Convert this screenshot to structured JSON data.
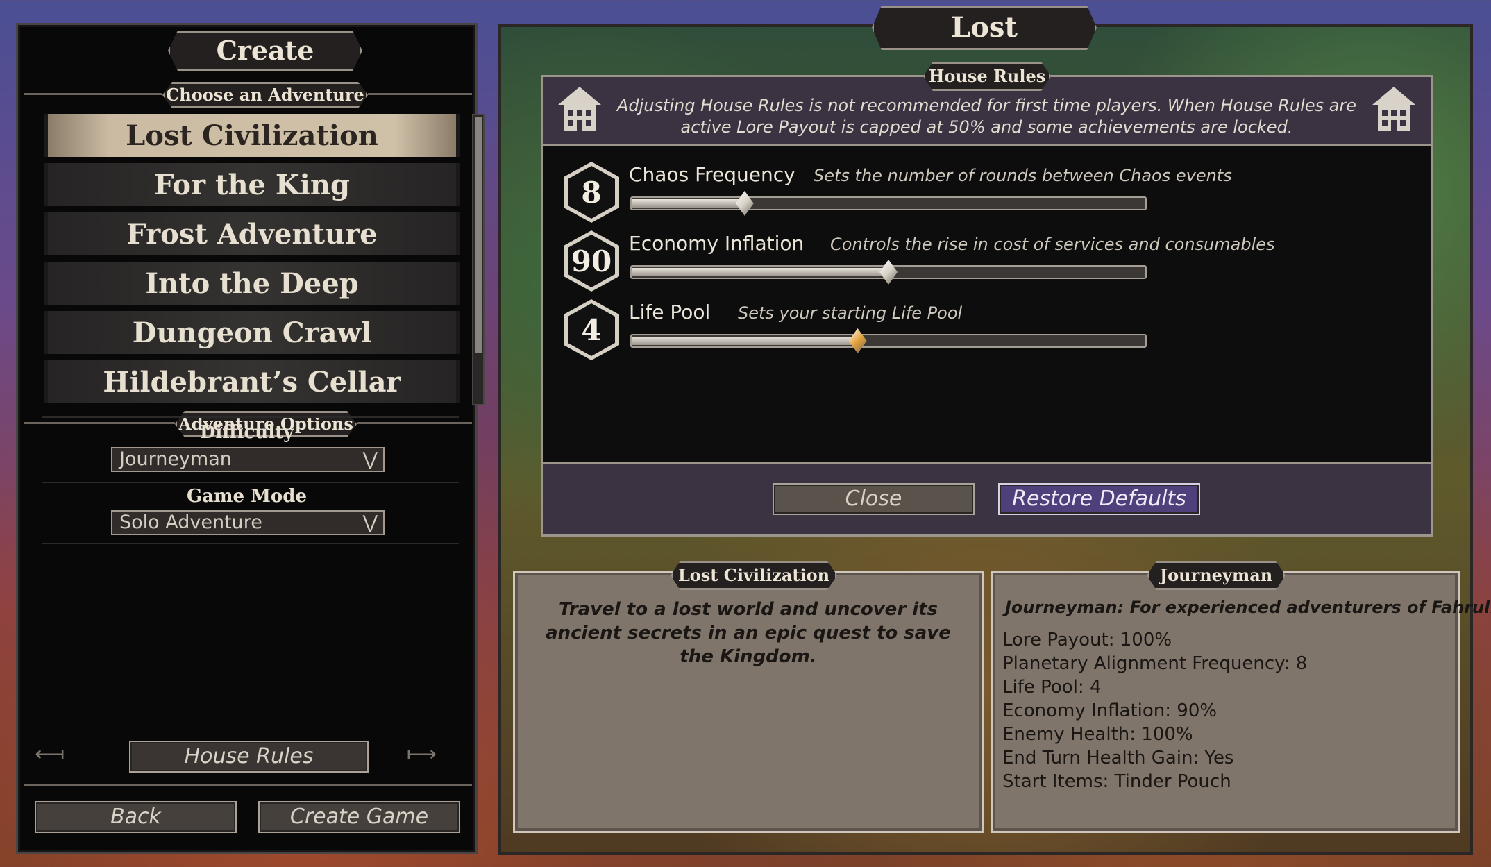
{
  "left_panel": {
    "title": "Create Game",
    "choose_adventure": "Choose an Adventure",
    "adventures": [
      {
        "label": "Lost Civilization",
        "selected": true
      },
      {
        "label": "For the King",
        "selected": false
      },
      {
        "label": "Frost Adventure",
        "selected": false
      },
      {
        "label": "Into the Deep",
        "selected": false
      },
      {
        "label": "Dungeon Crawl",
        "selected": false
      },
      {
        "label": "Hildebrant’s Cellar",
        "selected": false
      }
    ],
    "adventure_options": "Adventure Options",
    "difficulty_label": "Difficulty",
    "difficulty_value": "Journeyman",
    "game_mode_label": "Game Mode",
    "game_mode_value": "Solo Adventure",
    "house_rules_button": "House Rules",
    "back_button": "Back",
    "create_game_button": "Create Game"
  },
  "right_panel": {
    "title": "Lost Civilization",
    "house_rules": {
      "title": "House Rules",
      "warning": "Adjusting House Rules is not recommended for first time players. When House Rules are active Lore Payout is capped at 50% and some achievements are locked.",
      "settings": [
        {
          "value": "8",
          "name": "Chaos Frequency",
          "description": "Sets the number of rounds between Chaos events",
          "level": 0.22,
          "thumb_color": "#d8d2c8"
        },
        {
          "value": "90",
          "name": "Economy Inflation",
          "description": "Controls the rise in cost of services and consumables",
          "level": 0.5,
          "thumb_color": "#d8d2c8"
        },
        {
          "value": "4",
          "name": "Life Pool",
          "description": "Sets your starting Life Pool",
          "level": 0.44,
          "thumb_color": "#e2a13a"
        }
      ],
      "close_button": "Close",
      "restore_button": "Restore Defaults"
    },
    "adventure_info": {
      "title": "Lost Civilization",
      "description": "Travel to a lost world and uncover its ancient secrets in an epic quest to save the Kingdom."
    },
    "difficulty_info": {
      "title": "Journeyman",
      "description": "Journeyman: For experienced adventurers of Fahrul.",
      "stats": [
        "Lore Payout: 100%",
        "Planetary Alignment Frequency: 8",
        "Life Pool: 4",
        "Economy Inflation: 90%",
        "Enemy Health: 100%",
        "End Turn Health Gain: Yes",
        "Start Items: Tinder Pouch"
      ]
    }
  },
  "icons": {
    "house": "house-icon",
    "chevron": "chevron-down-icon"
  },
  "colors": {
    "accent_purple": "#4f3f7a",
    "selected_scroll": "#cfc1a8",
    "life_pool_thumb": "#e2a13a"
  }
}
